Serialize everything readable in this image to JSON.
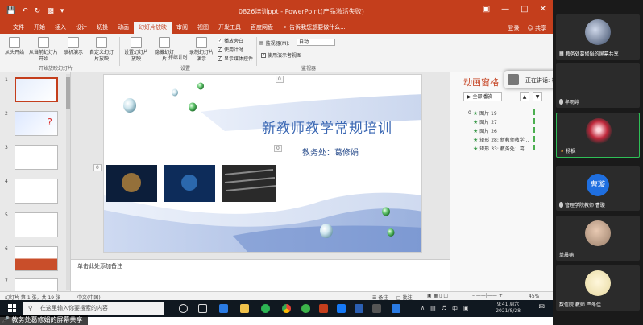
{
  "powerpoint": {
    "doc_title": "0826培训ppt - PowerPoint(产品激活失败)",
    "tabs": [
      "文件",
      "开始",
      "插入",
      "设计",
      "切换",
      "动画",
      "幻灯片放映",
      "审阅",
      "视图",
      "开发工具",
      "百度网盘"
    ],
    "active_tab_index": 6,
    "search_hint": "告诉我您想要做什么...",
    "login_label": "登录",
    "share_label": "共享",
    "ribbon": {
      "from_start": "从头开始",
      "from_current": "从当前幻灯片开始",
      "online": "联机演示",
      "custom": "自定义幻灯片放映",
      "group_start": "开始放映幻灯片",
      "setup": "设置幻灯片放映",
      "hide": "隐藏幻灯片",
      "rehearse": "排练计时",
      "record": "录制幻灯片演示",
      "chk_narration": "播放旁白",
      "chk_timing": "使用计时",
      "chk_media": "显示媒体控件",
      "group_setup": "设置",
      "monitor_label": "监视器(M):",
      "monitor_value": "自动",
      "chk_presenter": "使用演示者视图",
      "group_monitor": "监视器"
    },
    "slide": {
      "title": "新教师教学常规培训",
      "subtitle": "教务处：葛修娟",
      "placeholder_nums": [
        "0",
        "0",
        "0"
      ]
    },
    "slide_numbers": [
      "1",
      "2",
      "3",
      "4",
      "5",
      "6",
      "7"
    ],
    "notes_placeholder": "单击此处添加备注",
    "animation_pane": {
      "title": "动画窗格",
      "play_all": "全部播放",
      "items": [
        {
          "index": "0",
          "label": "图片 19"
        },
        {
          "index": "",
          "label": "图片 27"
        },
        {
          "index": "",
          "label": "图片 26"
        },
        {
          "index": "",
          "label": "矩形 28: 新教师教学..."
        },
        {
          "index": "",
          "label": "矩形 33: 教务处：葛..."
        }
      ]
    },
    "status": {
      "slide_info": "幻灯片 第 1 张，共 19 张",
      "language": "中文(中国)",
      "notes_btn": "备注",
      "comments_btn": "批注",
      "zoom": "45%"
    }
  },
  "taskbar": {
    "search_placeholder": "在这里输入你要搜索的内容",
    "time": "9:41 周六",
    "date": "2021/8/28",
    "ime": "中"
  },
  "screen_share_label": "教务处葛修娟的屏幕共享",
  "speaking": {
    "text": "正在讲话: 杨枫"
  },
  "participants": [
    {
      "name": "教务处葛修娟的屏幕共享",
      "type": "photo",
      "color": "#3a4a66"
    },
    {
      "name": "牟雨婷",
      "type": "dark",
      "color": "#2b2b2b"
    },
    {
      "name": "杨枫",
      "type": "photo",
      "color": "#c0283b"
    },
    {
      "name": "管理学院教师 曹璇",
      "type": "text",
      "avatar_text": "曹璇",
      "color": "#1f6fe0"
    },
    {
      "name": "单晨楠",
      "type": "photo",
      "color": "#9a7f6a"
    },
    {
      "name": "数信院 教师 严冬佳",
      "type": "photo",
      "color": "#e7d9a0"
    }
  ],
  "colors": {
    "ppt_accent": "#c43e1c",
    "slide_title": "#3a67b3",
    "anim_green": "#3b9a4b"
  }
}
